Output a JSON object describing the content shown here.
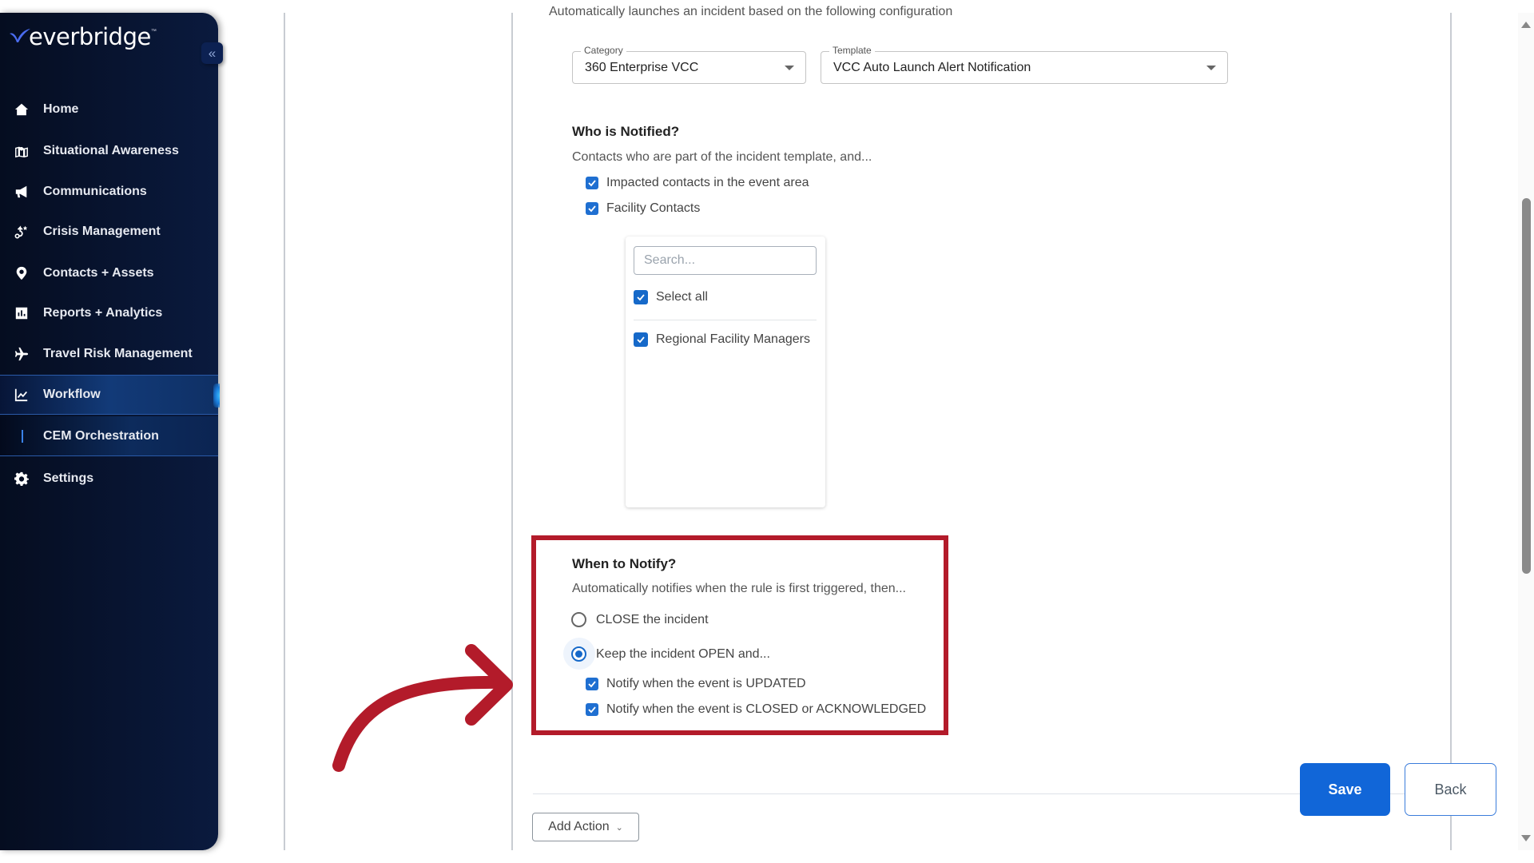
{
  "brand": {
    "name": "everbridge",
    "trademark": "™",
    "accent": "#3b5bdb"
  },
  "sidebar": {
    "collapse_label": "«",
    "items": [
      {
        "label": "Home",
        "icon": "home-icon"
      },
      {
        "label": "Situational Awareness",
        "icon": "map-icon"
      },
      {
        "label": "Communications",
        "icon": "megaphone-icon"
      },
      {
        "label": "Crisis Management",
        "icon": "route-icon"
      },
      {
        "label": "Contacts + Assets",
        "icon": "location-pin-icon"
      },
      {
        "label": "Reports + Analytics",
        "icon": "bar-chart-icon"
      },
      {
        "label": "Travel Risk Management",
        "icon": "airplane-icon"
      },
      {
        "label": "Workflow",
        "icon": "line-chart-icon",
        "active": true
      },
      {
        "label": "CEM Orchestration",
        "sub": true
      },
      {
        "label": "Settings",
        "icon": "gear-icon"
      }
    ]
  },
  "main": {
    "description": "Automatically launches an incident based on the following configuration",
    "category": {
      "label": "Category",
      "value": "360 Enterprise VCC"
    },
    "template": {
      "label": "Template",
      "value": "VCC Auto Launch Alert Notification"
    },
    "who": {
      "title": "Who is Notified?",
      "subtitle": "Contacts who are part of the incident template, and...",
      "options": [
        {
          "label": "Impacted contacts in the event area",
          "checked": true
        },
        {
          "label": "Facility Contacts",
          "checked": true
        }
      ],
      "facility_panel": {
        "search_placeholder": "Search...",
        "search_value": "",
        "select_all": {
          "label": "Select all",
          "checked": true
        },
        "items": [
          {
            "label": "Regional Facility Managers",
            "checked": true
          }
        ]
      }
    },
    "when": {
      "title": "When to Notify?",
      "subtitle": "Automatically notifies when the rule is first triggered, then...",
      "radios": [
        {
          "label": "CLOSE the incident",
          "selected": false
        },
        {
          "label": "Keep the incident OPEN and...",
          "selected": true
        }
      ],
      "sub_options": [
        {
          "label": "Notify when the event is UPDATED",
          "checked": true
        },
        {
          "label": "Notify when the event is CLOSED or ACKNOWLEDGED",
          "checked": true
        }
      ]
    },
    "annotation": {
      "highlight_color": "#b31b2a"
    },
    "buttons": {
      "save": "Save",
      "back": "Back",
      "add_action": "Add Action"
    }
  }
}
